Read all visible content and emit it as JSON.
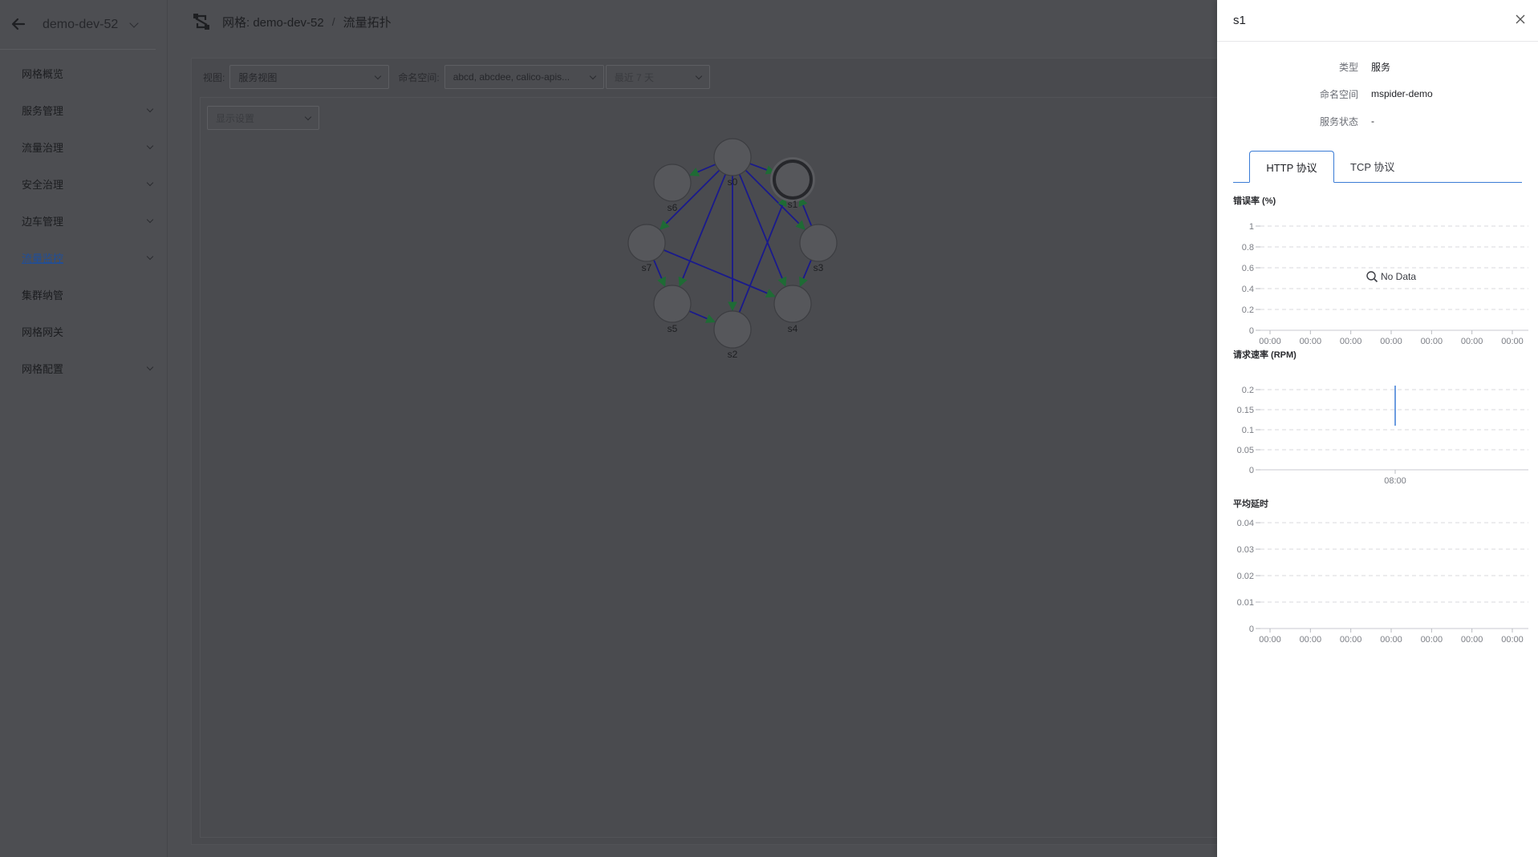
{
  "sidebar": {
    "mesh_name": "demo-dev-52",
    "items": [
      {
        "label": "网格概览",
        "expandable": false,
        "active": false
      },
      {
        "label": "服务管理",
        "expandable": true,
        "active": false
      },
      {
        "label": "流量治理",
        "expandable": true,
        "active": false
      },
      {
        "label": "安全治理",
        "expandable": true,
        "active": false
      },
      {
        "label": "边车管理",
        "expandable": true,
        "active": false
      },
      {
        "label": "流量监控",
        "expandable": true,
        "active": true
      },
      {
        "label": "集群纳管",
        "expandable": false,
        "active": false
      },
      {
        "label": "网格网关",
        "expandable": false,
        "active": false
      },
      {
        "label": "网格配置",
        "expandable": true,
        "active": false
      }
    ]
  },
  "header": {
    "mesh_crumb": "网格:  demo-dev-52",
    "separator": "/",
    "page_crumb": "流量拓扑"
  },
  "filters": {
    "view_label": "视图:",
    "view_value": "服务视图",
    "namespace_label": "命名空间:",
    "namespace_value": "abcd, abcdee, calico-apis...",
    "time_value": "最近 7 天",
    "display_settings": "显示设置"
  },
  "topology": {
    "nodes": [
      {
        "id": "s0",
        "label": "s0",
        "selected": false
      },
      {
        "id": "s1",
        "label": "s1",
        "selected": true
      },
      {
        "id": "s2",
        "label": "s2",
        "selected": false
      },
      {
        "id": "s3",
        "label": "s3",
        "selected": false
      },
      {
        "id": "s4",
        "label": "s4",
        "selected": false
      },
      {
        "id": "s5",
        "label": "s5",
        "selected": false
      },
      {
        "id": "s6",
        "label": "s6",
        "selected": false
      },
      {
        "id": "s7",
        "label": "s7",
        "selected": false
      }
    ],
    "edges": [
      [
        "s0",
        "s6"
      ],
      [
        "s0",
        "s1"
      ],
      [
        "s0",
        "s7"
      ],
      [
        "s0",
        "s2"
      ],
      [
        "s0",
        "s5"
      ],
      [
        "s0",
        "s3"
      ],
      [
        "s0",
        "s4"
      ],
      [
        "s3",
        "s1"
      ],
      [
        "s3",
        "s4"
      ],
      [
        "s7",
        "s5"
      ],
      [
        "s7",
        "s4"
      ],
      [
        "s5",
        "s2"
      ],
      [
        "s2",
        "s1"
      ]
    ],
    "edge_color": "#1a1a8c",
    "arrow_color": "#1f6b35"
  },
  "drawer": {
    "title": "s1",
    "close_icon": "close-icon",
    "info": [
      {
        "key": "类型",
        "value": "服务"
      },
      {
        "key": "命名空间",
        "value": "mspider-demo"
      },
      {
        "key": "服务状态",
        "value": "-"
      }
    ],
    "tabs": [
      {
        "label": "HTTP 协议",
        "active": true
      },
      {
        "label": "TCP 协议",
        "active": false
      }
    ]
  },
  "chart_data": [
    {
      "type": "line",
      "title": "错误率 (%)",
      "x": [
        "00:00",
        "00:00",
        "00:00",
        "00:00",
        "00:00",
        "00:00",
        "00:00"
      ],
      "yticks": [
        "0",
        "0.2",
        "0.4",
        "0.6",
        "0.8",
        "1"
      ],
      "ylim": [
        0,
        1
      ],
      "series": [],
      "empty_text": "No Data",
      "grid": true
    },
    {
      "type": "line",
      "title": "请求速率 (RPM)",
      "x": [
        "08:00"
      ],
      "yticks": [
        "0",
        "0.05",
        "0.1",
        "0.15",
        "0.2"
      ],
      "ylim": [
        0,
        0.2
      ],
      "series": [
        {
          "values": [
            0.21,
            0.11
          ]
        }
      ],
      "grid": true
    },
    {
      "type": "line",
      "title": "平均延时",
      "x": [
        "00:00",
        "00:00",
        "00:00",
        "00:00",
        "00:00",
        "00:00",
        "00:00"
      ],
      "yticks": [
        "0",
        "0.01",
        "0.02",
        "0.03",
        "0.04"
      ],
      "ylim": [
        0,
        0.04
      ],
      "series": [],
      "grid": true
    }
  ],
  "colors": {
    "accent": "#3a7bd5",
    "overlay": "#4d4e52",
    "active_nav": "#1f4e9b"
  }
}
